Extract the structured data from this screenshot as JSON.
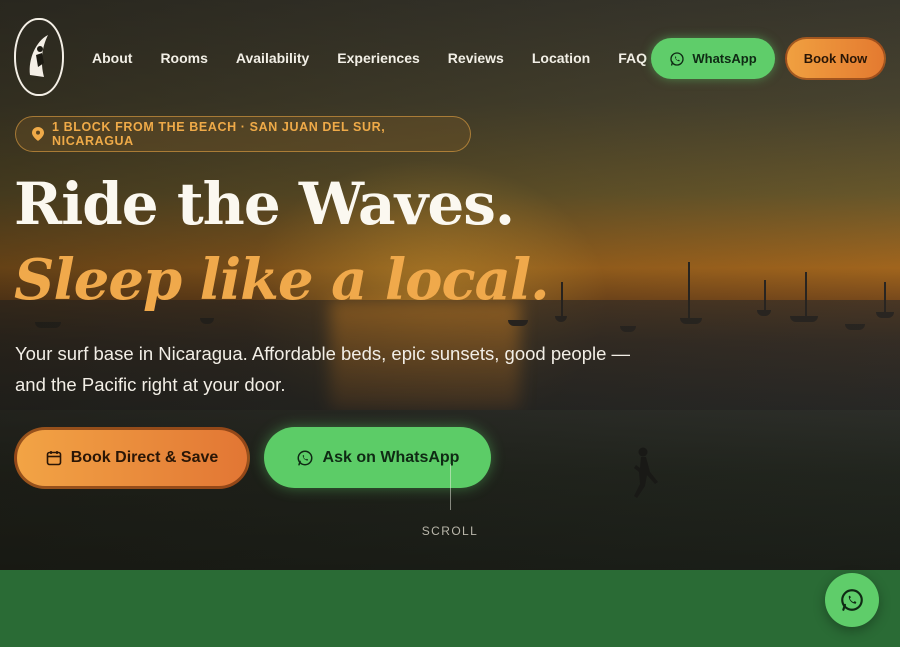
{
  "brand": {
    "logo_alt": "Hostal Los Chanos San Juan del Sur"
  },
  "nav": {
    "items": [
      "About",
      "Rooms",
      "Availability",
      "Experiences",
      "Reviews",
      "Location",
      "FAQ"
    ],
    "whatsapp_label": "WhatsApp",
    "book_label": "Book Now"
  },
  "hero": {
    "badge": "1 BLOCK FROM THE BEACH · SAN JUAN DEL SUR, NICARAGUA",
    "headline": "Ride the Waves.",
    "subheadline": "Sleep like a local.",
    "lead": "Your surf base in Nicaragua. Affordable beds, epic sunsets, good people — and the Pacific right at your door.",
    "cta_book": "Book Direct & Save",
    "cta_whatsapp": "Ask on WhatsApp",
    "scroll_label": "SCROLL"
  },
  "icons": {
    "pin": "map-pin-icon",
    "calendar": "calendar-icon",
    "whatsapp": "whatsapp-icon"
  },
  "colors": {
    "accent_orange": "#f0a040",
    "whatsapp_green": "#5fcd6a",
    "section_green": "#2a6b35"
  }
}
